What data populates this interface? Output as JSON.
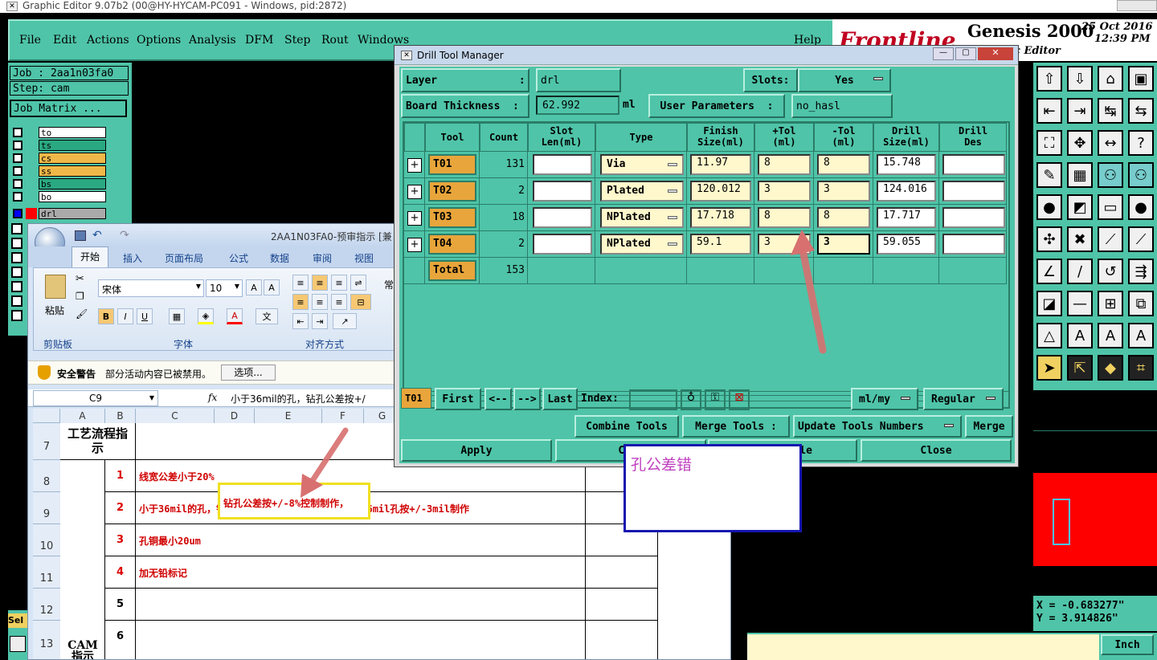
{
  "genesis": {
    "window_title": "Graphic Editor 9.07b2 (00@HY-HYCAM-PC091 - Windows, pid:2872)",
    "menu": [
      "File",
      "Edit",
      "Actions",
      "Options",
      "Analysis",
      "DFM",
      "Step",
      "Rout",
      "Windows",
      "Help"
    ],
    "brand": "Frontline",
    "product": "Genesis 2000",
    "editor_sub": "c Editor",
    "date": "25 Oct 2016",
    "time": "12:39 PM",
    "job": "Job : 2aa1n03fa0",
    "step": "Step: cam",
    "job_matrix": "Job Matrix ...",
    "layers": [
      {
        "name": "to",
        "color": "#ffffff"
      },
      {
        "name": "ts",
        "color": "#2aa882"
      },
      {
        "name": "cs",
        "color": "#f0b848"
      },
      {
        "name": "ss",
        "color": "#f0b848"
      },
      {
        "name": "bs",
        "color": "#2aa882"
      },
      {
        "name": "bo",
        "color": "#ffffff"
      }
    ],
    "work_layer": "drl",
    "coord_x": "X = -0.683277\"",
    "coord_y": "Y = 3.914826\"",
    "units": "Inch",
    "sel_label": "Sel"
  },
  "excel": {
    "title": "2AA1N03FA0-预审指示 [兼",
    "tabs": [
      "开始",
      "插入",
      "页面布局",
      "公式",
      "数据",
      "审阅",
      "视图"
    ],
    "font": "宋体",
    "size": "10",
    "paste": "粘贴",
    "groups": [
      "剪贴板",
      "字体",
      "对齐方式"
    ],
    "extra_tab": "常",
    "security_label": "安全警告",
    "security_msg": "部分活动内容已被禁用。",
    "options_btn": "选项...",
    "namebox": "C9",
    "fx": "fx",
    "formula": "小于36mil的孔，钻孔公差按+/",
    "columns": [
      "A",
      "B",
      "C",
      "D",
      "E",
      "F",
      "G"
    ],
    "rows": [
      {
        "n": "7",
        "b": "",
        "text": ""
      },
      {
        "n": "8",
        "b": "1",
        "text": "线宽公差小于20%"
      },
      {
        "n": "9",
        "b": "2",
        "text": "小于36mil的孔，钻孔公差按+/-8%控制制作，大于36mil孔按+/-3mil制作"
      },
      {
        "n": "10",
        "b": "3",
        "text": "孔铜最小20um"
      },
      {
        "n": "11",
        "b": "4",
        "text": "加无铅标记"
      },
      {
        "n": "12",
        "b": "5",
        "text": ""
      },
      {
        "n": "13",
        "b": "6",
        "text": ""
      }
    ],
    "row7_a": "工艺流程指示",
    "cam_label": "CAM 指示",
    "highlight": "钻孔公差按+/-8%控制制作，"
  },
  "dtm": {
    "title": "Drill Tool Manager",
    "layer_label": "Layer             :",
    "layer_value": "drl",
    "slots_label": "Slots:",
    "slots_value": "Yes",
    "thickness_label": "Board Thickness  :",
    "thickness_value": "62.992",
    "thickness_unit": "ml",
    "user_params_label": "User Parameters  :",
    "user_params_value": "no_hasl",
    "headers": [
      "Tool",
      "Count",
      "Slot Len(ml)",
      "Type",
      "Finish Size(ml)",
      "+Tol (ml)",
      "-Tol (ml)",
      "Drill Size(ml)",
      "Drill Des"
    ],
    "tools": [
      {
        "tool": "T01",
        "count": "131",
        "slot": "",
        "type": "Via",
        "finish": "11.97",
        "ptol": "8",
        "ntol": "8",
        "drill": "15.748",
        "des": ""
      },
      {
        "tool": "T02",
        "count": "2",
        "slot": "",
        "type": "Plated",
        "finish": "120.012",
        "ptol": "3",
        "ntol": "3",
        "drill": "124.016",
        "des": ""
      },
      {
        "tool": "T03",
        "count": "18",
        "slot": "",
        "type": "NPlated",
        "finish": "17.718",
        "ptol": "8",
        "ntol": "8",
        "drill": "17.717",
        "des": ""
      },
      {
        "tool": "T04",
        "count": "2",
        "slot": "",
        "type": "NPlated",
        "finish": "59.1",
        "ptol": "3",
        "ntol": "3",
        "drill": "59.055",
        "des": ""
      }
    ],
    "total_label": "Total",
    "total_count": "153",
    "current_tool": "T01",
    "nav": [
      "First",
      "<--",
      "-->",
      "Last"
    ],
    "index_label": "Index:",
    "units_dd": "ml/my",
    "mode_dd": "Regular",
    "combine": "Combine Tools",
    "merge_label": "Merge Tools :",
    "update_dd": "Update Tools Numbers",
    "merge": "Merge",
    "apply": "Apply",
    "calc": "Calc",
    "table": "able",
    "close": "Close"
  },
  "note": "孔公差错",
  "colors": {
    "teal": "#4fc4a8",
    "accent_orange": "#e8a53b",
    "annotation_red": "#d87070",
    "note_text": "#c040c0"
  }
}
